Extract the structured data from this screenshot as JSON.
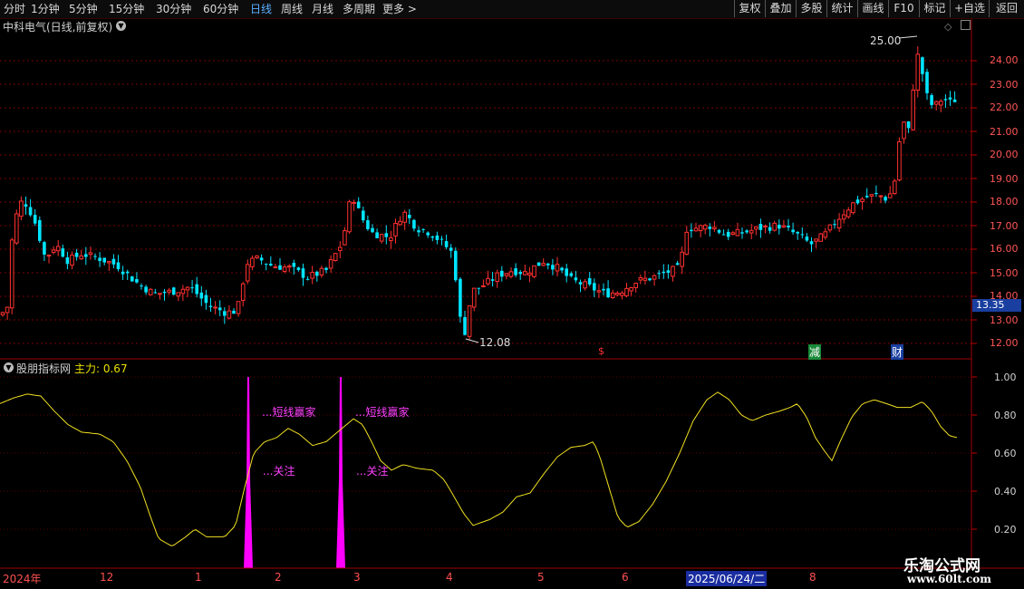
{
  "toolbar": {
    "periods": [
      "分时",
      "1分钟",
      "5分钟",
      "15分钟",
      "30分钟",
      "60分钟",
      "日线",
      "周线",
      "月线",
      "多周期",
      "更多 >"
    ],
    "active_period": "日线",
    "right_buttons": [
      "复权",
      "叠加",
      "多股",
      "统计",
      "画线",
      "F10",
      "标记",
      "+自选",
      "返回"
    ]
  },
  "stock": {
    "title": "中科电气(日线,前复权)"
  },
  "price_axis": {
    "labels": [
      "25.00",
      "24.00",
      "23.00",
      "22.00",
      "21.00",
      "20.00",
      "19.00",
      "18.00",
      "17.00",
      "16.00",
      "15.00",
      "14.00",
      "13.00",
      "12.00"
    ],
    "current_price": "13.35",
    "high_label": "25.00",
    "low_label": "12.08"
  },
  "markers": {
    "s": "$",
    "jian": "减",
    "cai": "财"
  },
  "indicator": {
    "title": "股朋指标网",
    "value_label": "主力: 0.67",
    "axis": [
      "1.00",
      "0.80",
      "0.60",
      "0.40",
      "0.20"
    ],
    "annotations": {
      "top1": "...短线赢家",
      "top2": "...短线赢家",
      "bot1": "...关注",
      "bot2": "...关注"
    }
  },
  "dates": {
    "labels": [
      "2024年",
      "12",
      "1",
      "2",
      "3",
      "4",
      "5",
      "6",
      "8"
    ],
    "selected": "2025/06/24/二"
  },
  "watermark": {
    "line1": "乐淘公式网",
    "line2": "www.60lt.com"
  },
  "colors": {
    "up": "#ff3030",
    "down": "#00e5ff",
    "line": "#f0e020",
    "signal": "#ff00ff",
    "grid": "#7a0000"
  }
}
